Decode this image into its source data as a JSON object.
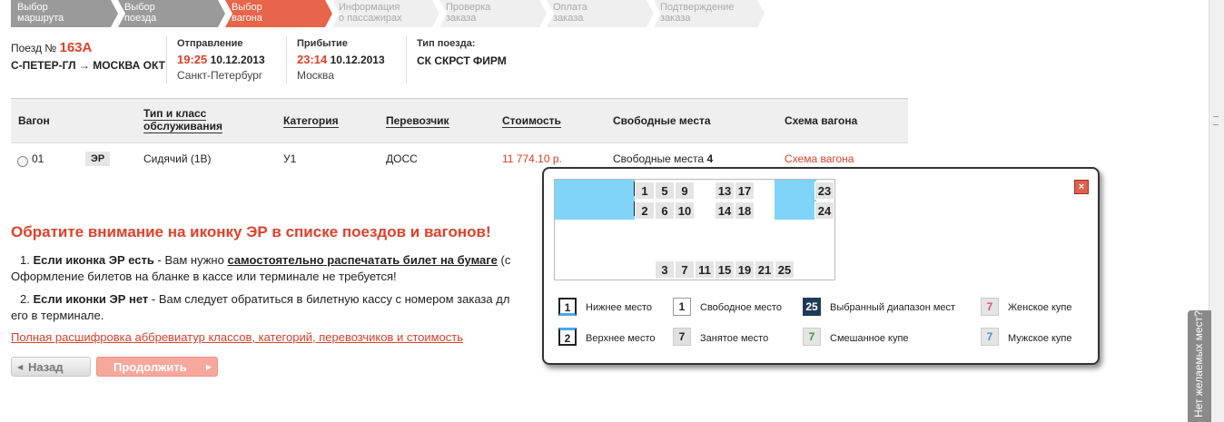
{
  "steps": [
    {
      "line1": "Выбор",
      "line2": "маршрута",
      "state": "done"
    },
    {
      "line1": "Выбор",
      "line2": "поезда",
      "state": "done"
    },
    {
      "line1": "Выбор",
      "line2": "вагона",
      "state": "active"
    },
    {
      "line1": "Информация",
      "line2": "о пассажирах",
      "state": "todo"
    },
    {
      "line1": "Проверка",
      "line2": "заказа",
      "state": "todo"
    },
    {
      "line1": "Оплата",
      "line2": "заказа",
      "state": "todo"
    },
    {
      "line1": "Подтверждение",
      "line2": "заказа",
      "state": "todo"
    }
  ],
  "train": {
    "label": "Поезд №",
    "number": "163А",
    "route": "С-ПЕТЕР-ГЛ → МОСКВА ОКТ"
  },
  "departure": {
    "label": "Отправление",
    "time": "19:25",
    "date": "10.12.2013",
    "city": "Санкт-Петербург"
  },
  "arrival": {
    "label": "Прибытие",
    "time": "23:14",
    "date": "10.12.2013",
    "city": "Москва"
  },
  "train_type": {
    "label": "Тип поезда:",
    "value": "СК СКРСТ ФИРМ"
  },
  "table": {
    "headers": {
      "wagon": "Вагон",
      "class1": "Тип и класс",
      "class2": "обслуживания",
      "category": "Категория",
      "carrier": "Перевозчик",
      "price": "Стоимость",
      "free": "Свободные места",
      "scheme": "Схема вагона"
    },
    "row": {
      "wagon": "01",
      "badge": "ЭР",
      "class": "Сидячий (1В)",
      "category": "У1",
      "carrier": "ДОСС",
      "price": "11 774.10 р.",
      "free_label": "Свободные места",
      "free_count": "4",
      "scheme_link": "Схема вагона"
    }
  },
  "notice": {
    "title": "Обратите внимание на иконку ЭР в списке поездов и вагонов!",
    "item1_num": "1.",
    "item1_bold": "Если иконка ЭР есть",
    "item1_text": " - Вам нужно ",
    "item1_u": "самостоятельно распечатать билет на бумаге",
    "item1_tail": " (с",
    "item1_line2": "Оформление билетов на бланке в кассе или терминале не требуется!",
    "item2_num": "2.",
    "item2_bold": "Если иконки ЭР нет",
    "item2_text": " - Вам следует обратиться в билетную кассу с номером заказа дл",
    "item2_line2": "его в терминале.",
    "full_link": "Полная расшифровка аббревиатур классов, категорий, перевозчиков и стоимость"
  },
  "buttons": {
    "back": "Назад",
    "next": "Продолжить"
  },
  "popup": {
    "close": "×",
    "top_seats_row1": [
      "1",
      "5",
      "9",
      "13",
      "17",
      "23"
    ],
    "top_seats_row2": [
      "2",
      "6",
      "10",
      "14",
      "18",
      "24"
    ],
    "bottom_seats": [
      "3",
      "7",
      "11",
      "15",
      "19",
      "21",
      "25"
    ],
    "legend": {
      "lower": {
        "num": "1",
        "label": "Нижнее место"
      },
      "free": {
        "num": "1",
        "label": "Свободное место"
      },
      "selected": {
        "num": "25",
        "label": "Выбранный диапазон мест"
      },
      "female": {
        "num": "7",
        "label": "Женское купе"
      },
      "upper": {
        "num": "2",
        "label": "Верхнее место"
      },
      "taken": {
        "num": "7",
        "label": "Занятое место"
      },
      "mixed": {
        "num": "7",
        "label": "Смешанное купе"
      },
      "male": {
        "num": "7",
        "label": "Мужское купе"
      }
    }
  },
  "sidetab": "Нет желаемых мест?",
  "colors": {
    "accent": "#e0402a",
    "seat_blue": "#80d4f8",
    "selected": "#1e3a58"
  }
}
